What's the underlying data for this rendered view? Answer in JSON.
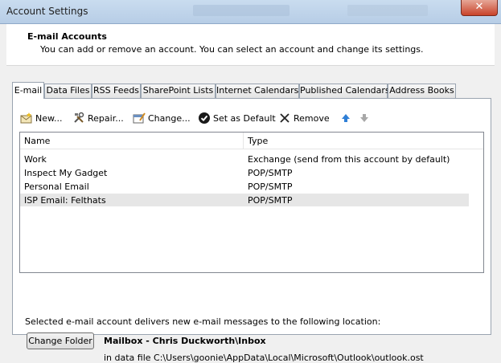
{
  "window": {
    "title": "Account Settings",
    "close_glyph": "✕"
  },
  "header": {
    "title": "E-mail Accounts",
    "description": "You can add or remove an account. You can select an account and change its settings."
  },
  "tabs": [
    {
      "label": "E-mail",
      "active": true
    },
    {
      "label": "Data Files",
      "active": false
    },
    {
      "label": "RSS Feeds",
      "active": false
    },
    {
      "label": "SharePoint Lists",
      "active": false
    },
    {
      "label": "Internet Calendars",
      "active": false
    },
    {
      "label": "Published Calendars",
      "active": false
    },
    {
      "label": "Address Books",
      "active": false
    }
  ],
  "toolbar": {
    "new_label": "New...",
    "repair_label": "Repair...",
    "change_label": "Change...",
    "default_label": "Set as Default",
    "remove_label": "Remove"
  },
  "accounts": {
    "columns": {
      "name": "Name",
      "type": "Type"
    },
    "rows": [
      {
        "name": "Work",
        "type": "Exchange (send from this account by default)",
        "selected": false
      },
      {
        "name": "Inspect My Gadget",
        "type": "POP/SMTP",
        "selected": false
      },
      {
        "name": "Personal Email",
        "type": "POP/SMTP",
        "selected": false
      },
      {
        "name": "ISP Email: Felthats",
        "type": "POP/SMTP",
        "selected": true
      }
    ]
  },
  "delivery": {
    "text": "Selected e-mail account delivers new e-mail messages to the following location:",
    "button_label": "Change Folder",
    "mailbox": "Mailbox - Chris Duckworth\\Inbox",
    "datafile": "in data file C:\\Users\\goonie\\AppData\\Local\\Microsoft\\Outlook\\outlook.ost"
  },
  "colors": {
    "titlebar": "#bcd1e8",
    "selected_row": "#e6e6e6",
    "close_button": "#c9432a",
    "up_arrow": "#2f7fd6"
  }
}
